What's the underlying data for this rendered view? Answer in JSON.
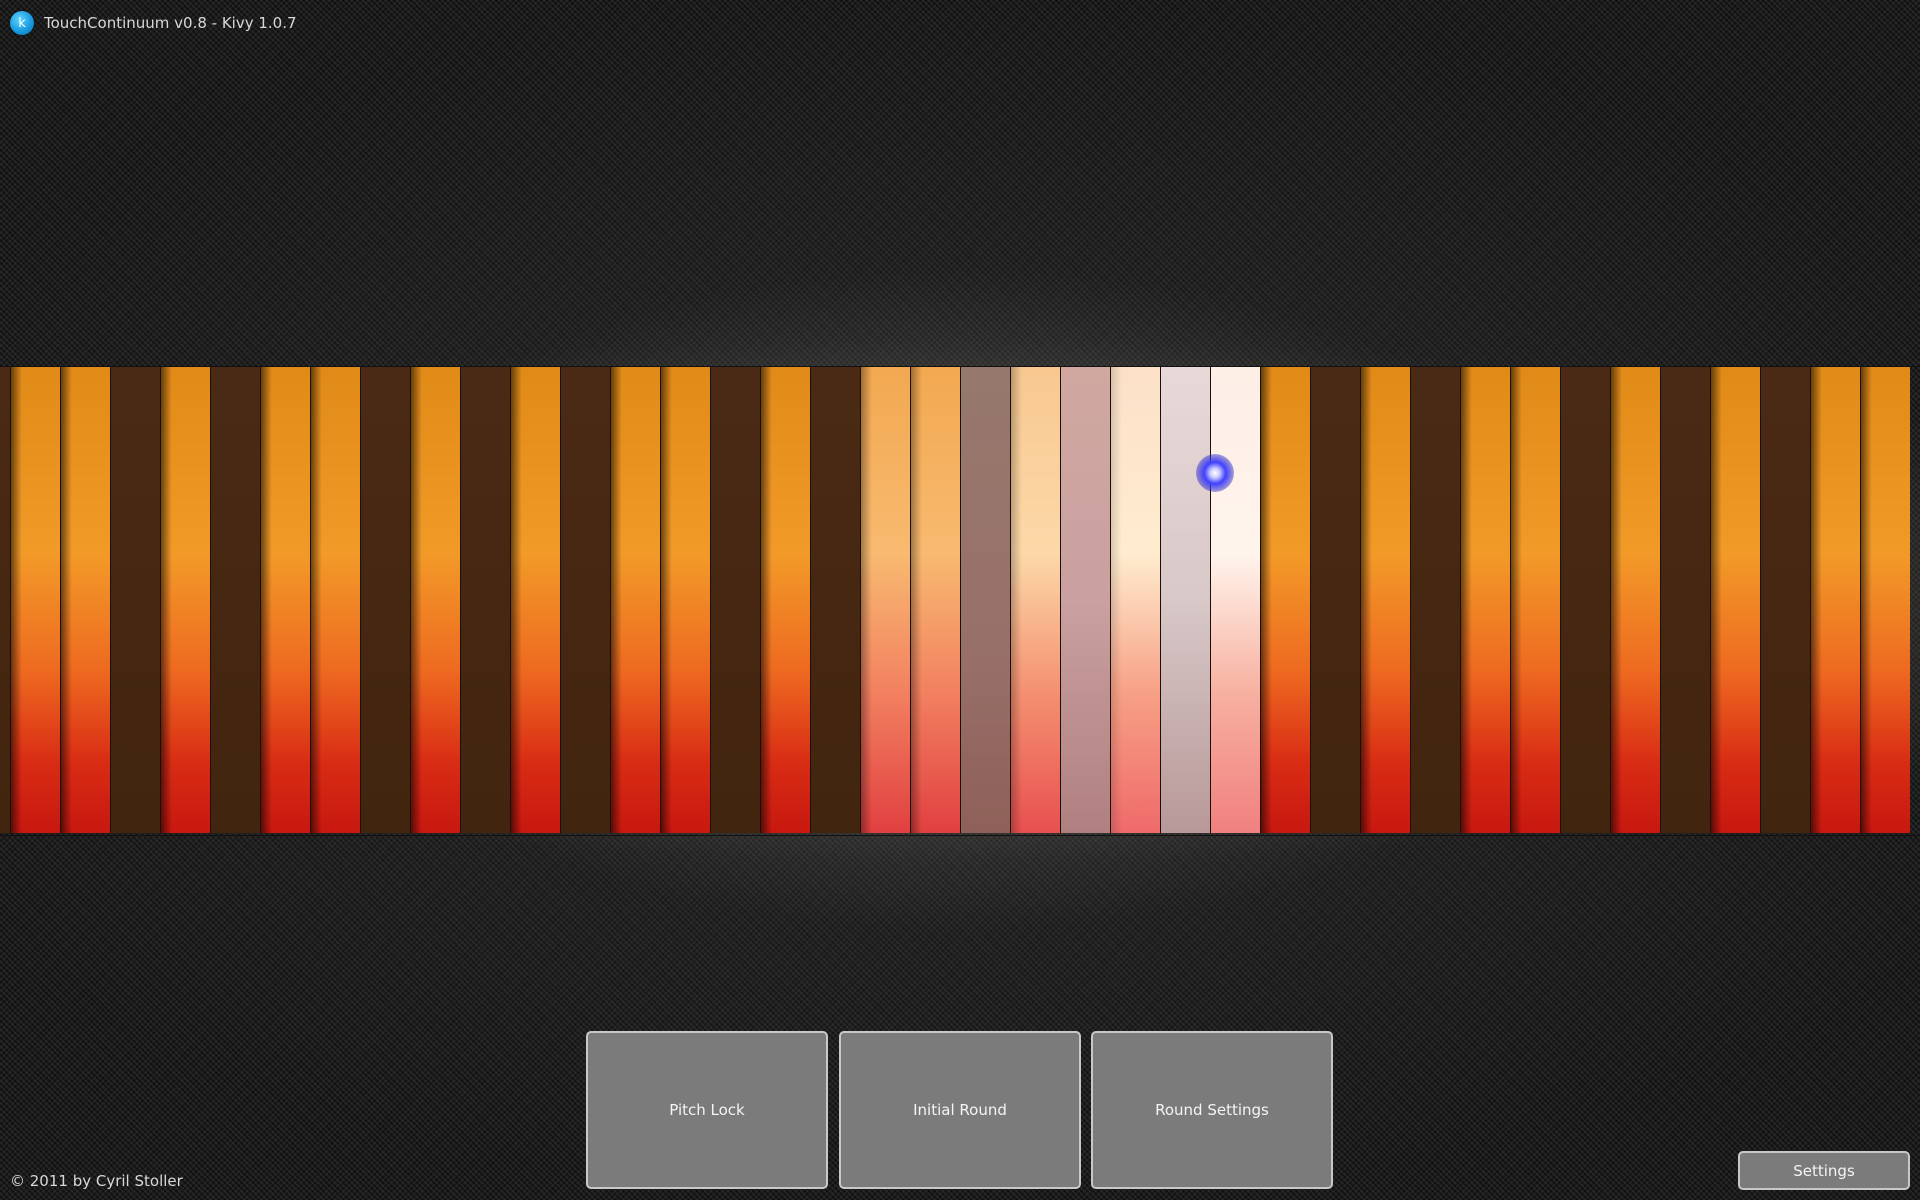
{
  "window": {
    "title": "TouchContinuum v0.8 - Kivy 1.0.7",
    "logo_letter": "k"
  },
  "keyboard": {
    "key_count": 39,
    "touch_active": true
  },
  "buttons": {
    "pitch_lock": "Pitch Lock",
    "initial_round": "Initial Round",
    "round_settings": "Round Settings",
    "settings": "Settings"
  },
  "footer": {
    "copyright": "© 2011 by Cyril Stoller"
  },
  "colors": {
    "key_light": "#f29a28",
    "key_dark": "#42250f",
    "touch_indicator": "#4040ff",
    "button_bg": "#7b7b7b"
  }
}
